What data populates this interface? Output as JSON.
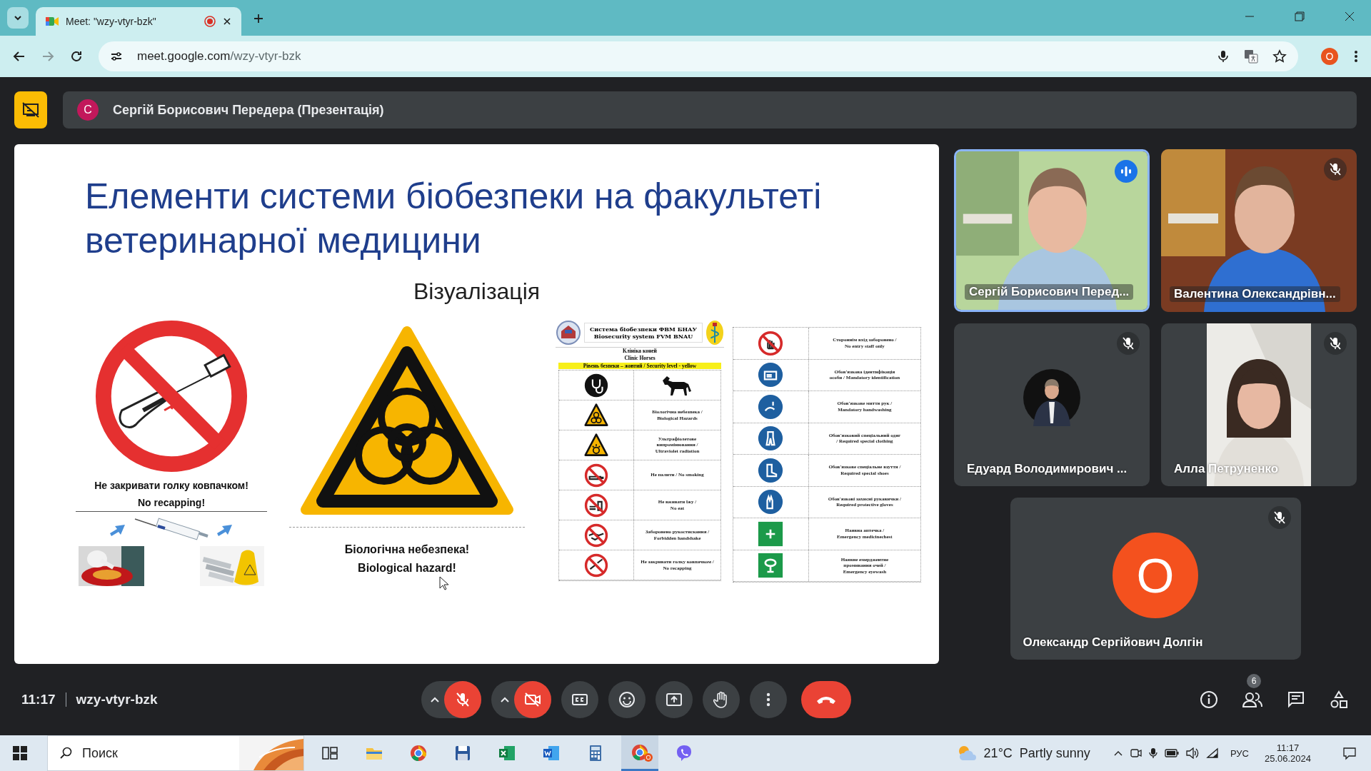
{
  "browser": {
    "tab_title": "Meet: \"wzy-vtyr-bzk\"",
    "recording": true,
    "url_host": "meet.google.com",
    "url_path": "/wzy-vtyr-bzk",
    "profile_initial": "O"
  },
  "presentation_bar": {
    "avatar_initial": "С",
    "presenter": "Сергій Борисович Передера (Презентація)"
  },
  "slide": {
    "title_lines": [
      "Елементи системи біобезпеки на факультеті",
      "ветеринарної медицини"
    ],
    "subtitle": "Візуалізація",
    "left_captions": [
      "Не закривати голку ковпачком!",
      "No recapping!"
    ],
    "middle_captions": [
      "Біологічна небезпека!",
      "Biological hazard!"
    ],
    "doc": {
      "titles": [
        "Система біобезпеки ФВМ БНАУ",
        "Biosecurity system FVM BNAU"
      ],
      "sections": [
        "Клініка коней",
        "Clinic Horses"
      ],
      "level": "Рівень безпеки – жовтий /  Security level - yellow"
    },
    "signs_left": [
      {
        "kind": "stethoscope",
        "label": {
          "kind": "horse"
        }
      },
      {
        "kind": "biohazard",
        "lines": [
          "Біологічна небезпека /",
          "Biological Hazards"
        ]
      },
      {
        "kind": "uv",
        "lines": [
          "Ультрафіолетове",
          "випромінювання /",
          "Ultraviolet radiation"
        ]
      },
      {
        "kind": "no-smoking",
        "lines": [
          "Не палити / No smoking"
        ]
      },
      {
        "kind": "no-eating",
        "lines": [
          "Не вживати їжу /",
          "No eat"
        ]
      },
      {
        "kind": "no-handshake",
        "lines": [
          "Заборонено рукостискання /",
          "Forbidden handshake"
        ]
      },
      {
        "kind": "no-recapping",
        "lines": [
          "Не закривати голку ковпачком /",
          "No recapping"
        ]
      }
    ],
    "signs_right": [
      {
        "kind": "no-entry",
        "lines": [
          "Стороннім вхід заборонено /",
          "No entry staff only"
        ]
      },
      {
        "kind": "id-card",
        "lines": [
          "Обов'язкова ідентифікація",
          "особи / Mandatory identification"
        ]
      },
      {
        "kind": "handwash",
        "lines": [
          "Обов'язкове миття рук /",
          "Mandatory handwashing"
        ]
      },
      {
        "kind": "clothing",
        "lines": [
          "Обов'язковий спеціальний одяг",
          "/ Required special clothing"
        ]
      },
      {
        "kind": "shoes",
        "lines": [
          "Обов'язкове спеціальне взуття /",
          "Required special shoes"
        ]
      },
      {
        "kind": "gloves",
        "lines": [
          "Обов'язкові захисні рукавички /",
          "Required protective gloves"
        ]
      },
      {
        "kind": "first-aid",
        "lines": [
          "Наявна аптечка /",
          "Emergency medicinechest"
        ]
      },
      {
        "kind": "eyewash",
        "lines": [
          "Наявне емерджентне",
          "промивання очей /",
          "Emergency eyewash"
        ]
      }
    ]
  },
  "participants": [
    {
      "name": "Сергій Борисович Перед...",
      "kind": "video",
      "speaking": true,
      "muted": false
    },
    {
      "name": "Валентина Олександрівн...",
      "kind": "video",
      "speaking": false,
      "muted": true
    },
    {
      "name": "Едуард Володимирович ...",
      "speaking": false,
      "muted": true
    },
    {
      "name": "Алла Петруненко",
      "kind": "portrait-video",
      "speaking": false,
      "muted": true
    },
    {
      "name": "Олександр Сергійович Долгін",
      "kind": "initial",
      "initial": "О",
      "speaking": false,
      "muted": true
    }
  ],
  "meeting_bar": {
    "time": "11:17",
    "code": "wzy-vtyr-bzk",
    "mic_on": false,
    "camera_on": false,
    "participant_count": "6"
  },
  "taskbar": {
    "search_placeholder": "Поиск",
    "apps": [
      {
        "kind": "task-view",
        "active": false
      },
      {
        "kind": "folder",
        "active": false
      },
      {
        "kind": "chrome",
        "active": false
      },
      {
        "kind": "floppy",
        "active": false
      },
      {
        "kind": "excel",
        "active": false
      },
      {
        "kind": "word",
        "active": false
      },
      {
        "kind": "calculator",
        "active": false
      },
      {
        "kind": "chrome",
        "active": true,
        "badge": "O"
      },
      {
        "kind": "viber",
        "active": false
      }
    ],
    "weather": "21°C  Partly sunny",
    "language": "РУС",
    "time": "11:17",
    "date": "25.06.2024"
  }
}
